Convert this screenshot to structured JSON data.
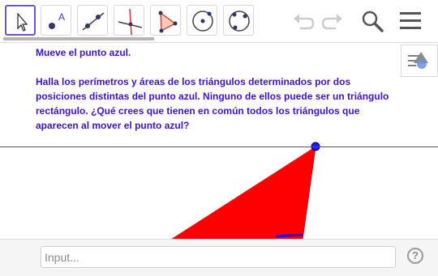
{
  "toolbar": {
    "tools": [
      {
        "icon": "move-arrow-icon",
        "selected": true
      },
      {
        "icon": "point-icon",
        "selected": false
      },
      {
        "icon": "line-icon",
        "selected": false
      },
      {
        "icon": "perpendicular-line-icon",
        "selected": false
      },
      {
        "icon": "polygon-icon",
        "selected": false
      },
      {
        "icon": "circle-center-icon",
        "selected": false
      },
      {
        "icon": "circle-three-points-icon",
        "selected": false
      }
    ],
    "actions": [
      "undo-icon",
      "redo-icon",
      "search-icon",
      "menu-icon"
    ]
  },
  "text": {
    "line1": "Mueve el punto azul.",
    "line2": "Halla los perímetros y áreas de los triángulos determinados por dos posiciones distintas del punto azul. Ninguno de ellos puede ser un triángulo rectángulo. ¿Qué crees que tienen en común todos los triángulos que aparecen al mover el punto azul?"
  },
  "input": {
    "placeholder": "Input..."
  },
  "help": {
    "label": "?"
  },
  "colors": {
    "accent": "#6557d2",
    "text": "#3b12d9",
    "triangle": "#ff0000",
    "point": "#1a1aff",
    "segment": "#3b12d9"
  }
}
